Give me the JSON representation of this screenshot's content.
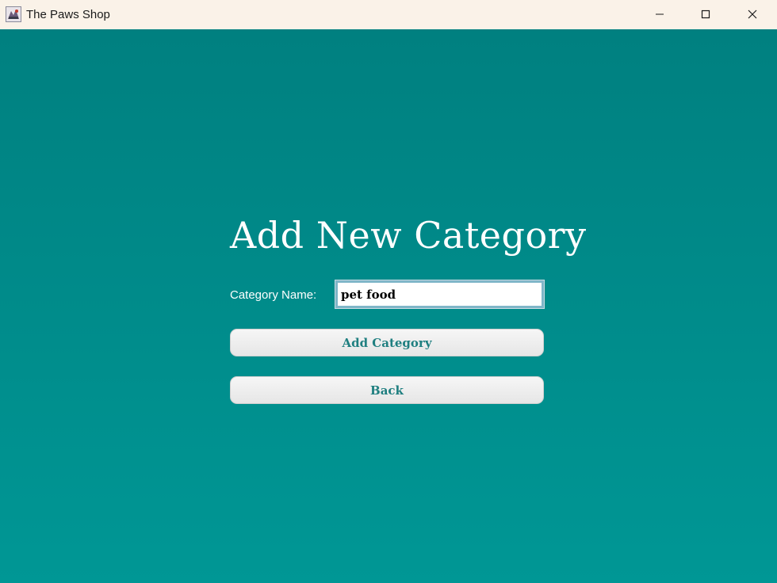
{
  "window": {
    "title": "The Paws Shop",
    "icons": {
      "app": "app-logo-icon",
      "minimize": "minimize-icon",
      "maximize": "maximize-icon",
      "close": "close-icon"
    }
  },
  "form": {
    "heading": "Add New Category",
    "category_label": "Category Name:",
    "category_value": "pet food",
    "add_button": "Add Category",
    "back_button": "Back"
  },
  "colors": {
    "background_top": "#008080",
    "background_bottom": "#009795",
    "titlebar": "#faf2e8",
    "button_text": "#1f7f80"
  }
}
